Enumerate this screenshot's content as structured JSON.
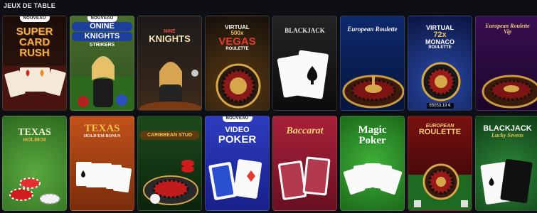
{
  "section": {
    "title": "JEUX DE TABLE"
  },
  "badges": {
    "new": "NOUVEAU"
  },
  "games": [
    {
      "title_lines": [
        "SUPER",
        "CARD",
        "RUSH"
      ],
      "badge": "NOUVEAU"
    },
    {
      "title_lines": [
        "ONINE",
        "KNIGHTS"
      ],
      "subtitle": "STRIKERS",
      "badge": "NOUVEAU"
    },
    {
      "title_lines": [
        "NINE",
        "KNIGHTS"
      ]
    },
    {
      "title_lines": [
        "VIRTUAL",
        "500x",
        "VEGAS"
      ],
      "subtitle": "ROULETTE"
    },
    {
      "title_lines": [
        "BLACKJACK"
      ]
    },
    {
      "title_lines": [
        "European Roulette"
      ]
    },
    {
      "title_lines": [
        "VIRTUAL",
        "72x",
        "MONACO"
      ],
      "subtitle": "ROULETTE",
      "jackpot": "65053,19 €"
    },
    {
      "title_lines": [
        "European Roulette",
        "Vip"
      ]
    },
    {
      "title_lines": [
        "TEXAS",
        "HOLDEM"
      ]
    },
    {
      "title_lines": [
        "TEXAS"
      ],
      "subtitle": "HOLD'EM BONUS"
    },
    {
      "title_lines": [
        "CARIBBEAN STUD"
      ]
    },
    {
      "title_lines": [
        "VIDEO",
        "POKER"
      ],
      "badge": "NOUVEAU"
    },
    {
      "title_lines": [
        "Baccarat"
      ]
    },
    {
      "title_lines": [
        "Magic",
        "Poker"
      ]
    },
    {
      "title_lines": [
        "EUROPEAN",
        "ROULETTE"
      ]
    },
    {
      "title_lines": [
        "BLACKJACK"
      ],
      "subtitle": "Lucky Sevens"
    }
  ],
  "colors": {
    "page_bg": "#0d0f14",
    "title_gold": "#f3c24a",
    "felt_green": "#3f8f3a",
    "felt_red": "#8c1e34",
    "royal_blue": "#1b2f8c"
  },
  "icons": [
    "card-spade-icon",
    "card-heart-icon",
    "roulette-wheel-icon",
    "poker-chips-icon"
  ]
}
